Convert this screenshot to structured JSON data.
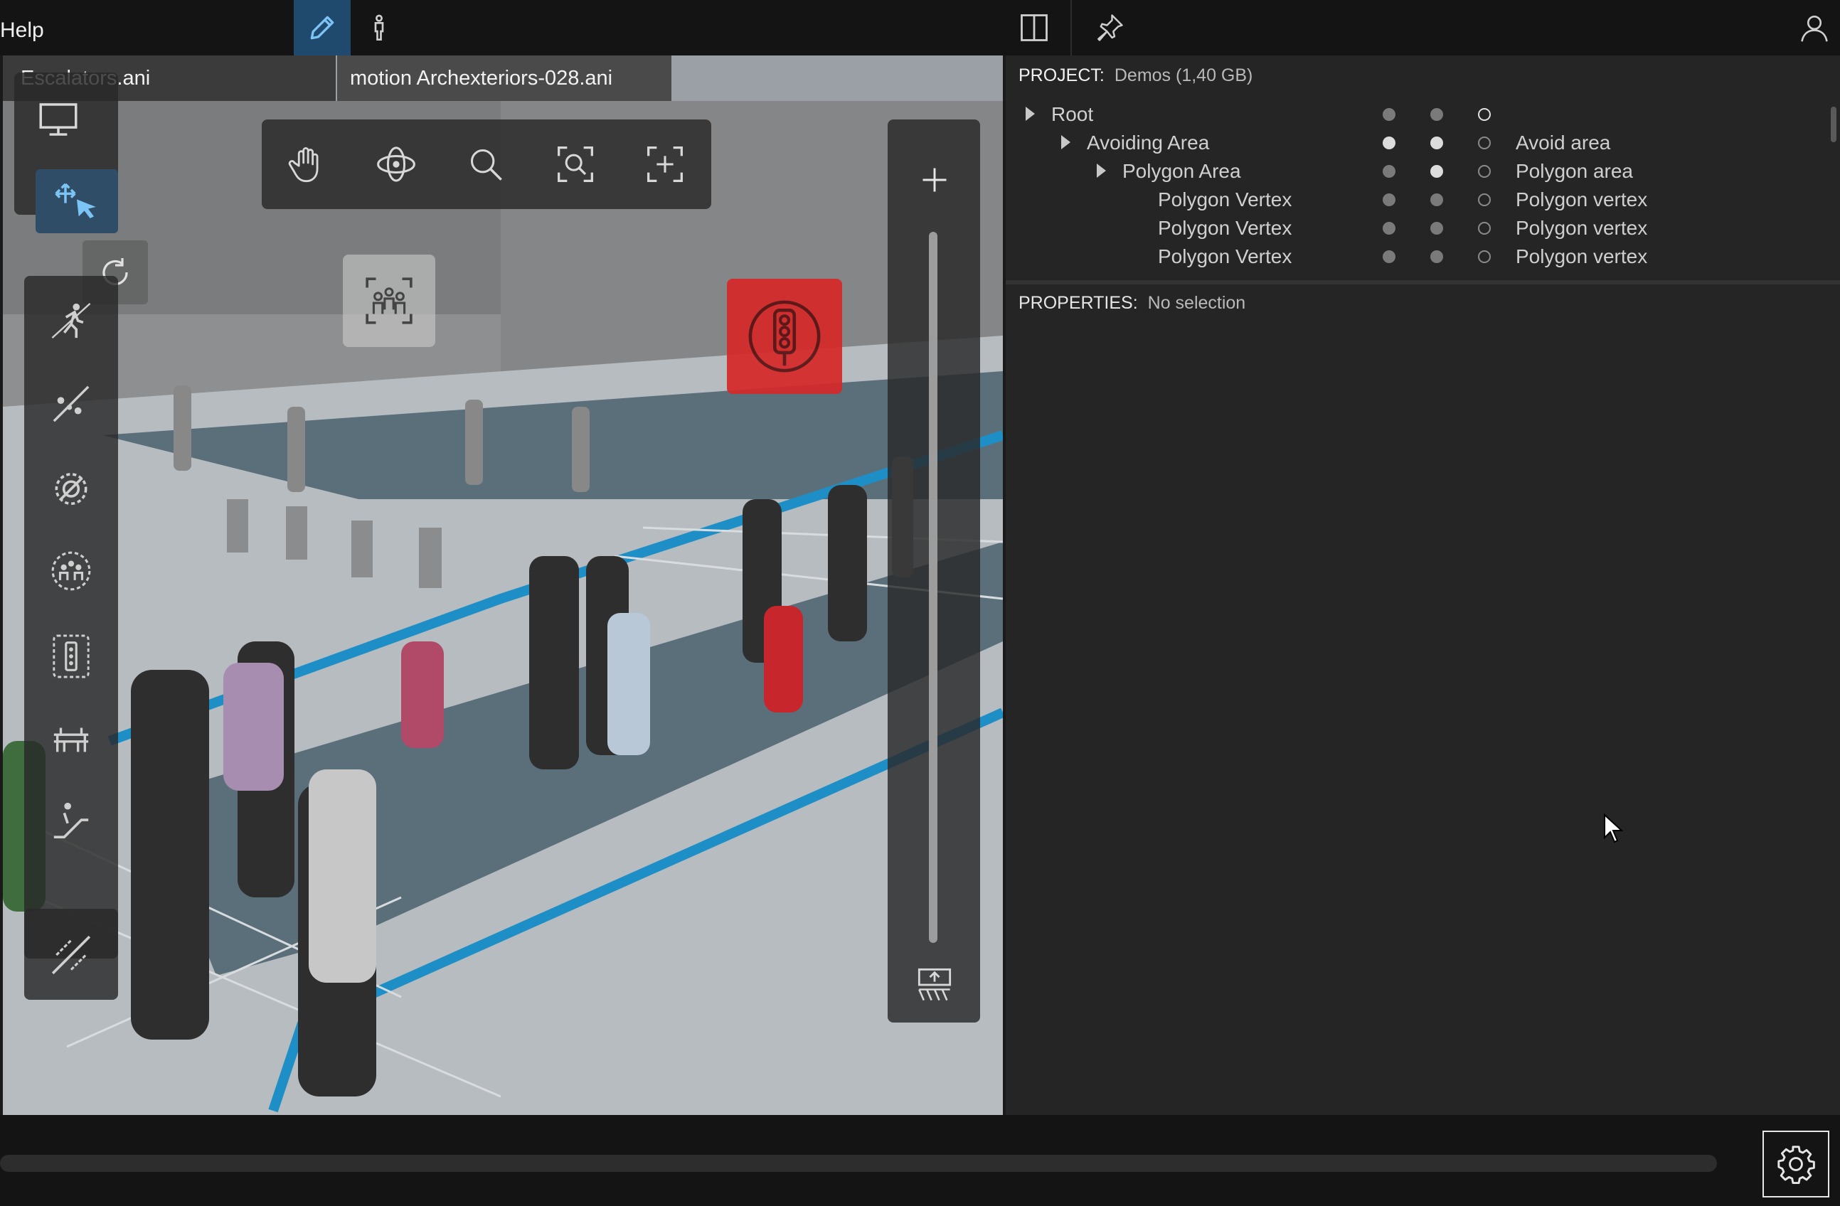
{
  "menu": {
    "help_label": "Help"
  },
  "tabs": [
    {
      "label": "Escalators.ani"
    },
    {
      "label": "motion Archexteriors-028.ani"
    }
  ],
  "project": {
    "label": "PROJECT:",
    "value": "Demos (1,40 GB)",
    "tree": [
      {
        "name": "Root",
        "type": "",
        "expandable": true
      },
      {
        "name": "Avoiding Area",
        "type": "Avoid area",
        "expandable": true
      },
      {
        "name": "Polygon Area",
        "type": "Polygon area",
        "expandable": true
      },
      {
        "name": "Polygon Vertex",
        "type": "Polygon vertex",
        "expandable": false
      },
      {
        "name": "Polygon Vertex",
        "type": "Polygon vertex",
        "expandable": false
      },
      {
        "name": "Polygon Vertex",
        "type": "Polygon vertex",
        "expandable": false
      }
    ]
  },
  "properties": {
    "label": "PROPERTIES:",
    "value": "No selection"
  },
  "icons": {
    "edit": "pencil-icon",
    "person": "person-icon",
    "layout": "split-panel-icon",
    "pin": "pin-icon",
    "user": "user-icon",
    "settings": "gear-icon"
  },
  "colors": {
    "accent": "#1f4a6e",
    "marker_red": "#d62828",
    "path_blue": "#1e8fc6"
  }
}
